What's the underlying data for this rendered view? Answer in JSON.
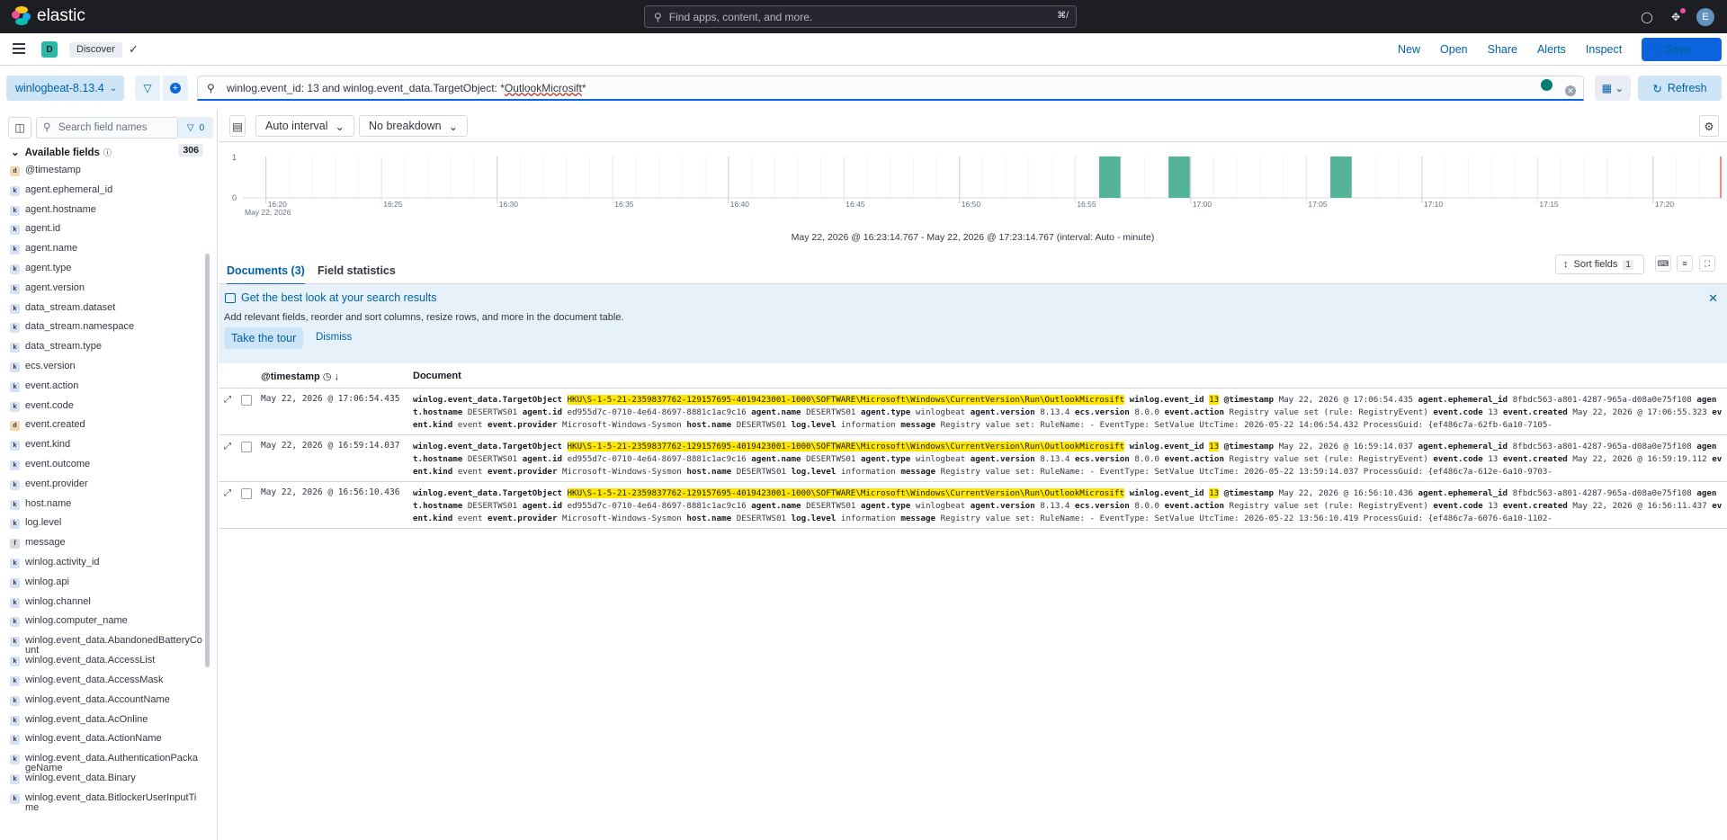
{
  "app": {
    "brand": "elastic",
    "search_placeholder": "Find apps, content, and more.",
    "search_shortcut": "⌘/",
    "avatar_letter": "E"
  },
  "nav": {
    "space_letter": "D",
    "breadcrumb": "Discover",
    "links": {
      "new": "New",
      "open": "Open",
      "share": "Share",
      "alerts": "Alerts",
      "inspect": "Inspect",
      "save": "Save"
    }
  },
  "query": {
    "data_view": "winlogbeat-8.13.4",
    "text_prefix": "winlog.event_id: 13 and winlog.event_data.TargetObject: *",
    "text_wavy": "OutlookMicrosift",
    "text_suffix": "*",
    "refresh": "Refresh"
  },
  "sidebar": {
    "search_placeholder": "Search field names",
    "filter_count": "0",
    "available_label": "Available fields",
    "available_count": "306",
    "fields": [
      {
        "type": "d",
        "name": "@timestamp"
      },
      {
        "type": "k",
        "name": "agent.ephemeral_id"
      },
      {
        "type": "k",
        "name": "agent.hostname"
      },
      {
        "type": "k",
        "name": "agent.id"
      },
      {
        "type": "k",
        "name": "agent.name"
      },
      {
        "type": "k",
        "name": "agent.type"
      },
      {
        "type": "k",
        "name": "agent.version"
      },
      {
        "type": "k",
        "name": "data_stream.dataset"
      },
      {
        "type": "k",
        "name": "data_stream.namespace"
      },
      {
        "type": "k",
        "name": "data_stream.type"
      },
      {
        "type": "k",
        "name": "ecs.version"
      },
      {
        "type": "k",
        "name": "event.action"
      },
      {
        "type": "k",
        "name": "event.code"
      },
      {
        "type": "d",
        "name": "event.created"
      },
      {
        "type": "k",
        "name": "event.kind"
      },
      {
        "type": "k",
        "name": "event.outcome"
      },
      {
        "type": "k",
        "name": "event.provider"
      },
      {
        "type": "k",
        "name": "host.name"
      },
      {
        "type": "k",
        "name": "log.level"
      },
      {
        "type": "f",
        "name": "message"
      },
      {
        "type": "k",
        "name": "winlog.activity_id"
      },
      {
        "type": "k",
        "name": "winlog.api"
      },
      {
        "type": "k",
        "name": "winlog.channel"
      },
      {
        "type": "k",
        "name": "winlog.computer_name"
      },
      {
        "type": "k",
        "name": "winlog.event_data.AbandonedBatteryCount"
      },
      {
        "type": "k",
        "name": "winlog.event_data.AccessList"
      },
      {
        "type": "k",
        "name": "winlog.event_data.AccessMask"
      },
      {
        "type": "k",
        "name": "winlog.event_data.AccountName"
      },
      {
        "type": "k",
        "name": "winlog.event_data.AcOnline"
      },
      {
        "type": "k",
        "name": "winlog.event_data.ActionName"
      },
      {
        "type": "k",
        "name": "winlog.event_data.AuthenticationPackageName"
      },
      {
        "type": "k",
        "name": "winlog.event_data.Binary"
      },
      {
        "type": "k",
        "name": "winlog.event_data.BitlockerUserInputTime"
      }
    ]
  },
  "histogram": {
    "interval_label": "Auto interval",
    "breakdown_label": "No breakdown",
    "y_max": "1",
    "y_min": "0",
    "bar_color": "#54b399",
    "x_ticks": [
      "16:20",
      "16:25",
      "16:30",
      "16:35",
      "16:40",
      "16:45",
      "16:50",
      "16:55",
      "17:00",
      "17:05",
      "17:10",
      "17:15",
      "17:20"
    ],
    "date_label": "May 22, 2026",
    "bars_at_minutes": [
      "16:56",
      "16:59",
      "17:06"
    ],
    "range_text": "May 22, 2026 @ 16:23:14.767 - May 22, 2026 @ 17:23:14.767 (interval: Auto - minute)"
  },
  "tabs": {
    "documents": "Documents (3)",
    "field_stats": "Field statistics",
    "sort_fields": "Sort fields",
    "sort_count": "1"
  },
  "callout": {
    "title": "Get the best look at your search results",
    "text": "Add relevant fields, reorder and sort columns, resize rows, and more in the document table.",
    "tour": "Take the tour",
    "dismiss": "Dismiss"
  },
  "table": {
    "col_timestamp": "@timestamp",
    "col_document": "Document",
    "rows": [
      {
        "ts": "May 22, 2026 @ 17:06:54.435",
        "target": "HKU\\S-1-5-21-2359837762-129157695-4019423001-1000\\SOFTWARE\\Microsoft\\Windows\\CurrentVersion\\Run\\OutlookMicrosift",
        "eid": "13",
        "ts2": "May 22, 2026 @ 17:06:54.435",
        "eph": "8fbdc563-a801-4287-965a-d08a0e75f108",
        "host": "DESERTWS01",
        "aid": "ed955d7c-0710-4e64-8697-8881c1ac9c16",
        "aname": "DESERTWS01",
        "atype": "winlogbeat",
        "aver": "8.13.4",
        "ecs": "8.0.0",
        "action": "Registry value set (rule: RegistryEvent)",
        "code": "13",
        "created": "May 22, 2026 @ 17:06:55.323",
        "kind": "event",
        "provider": "Microsoft-Windows-Sysmon",
        "hname": "DESERTWS01",
        "level": "information",
        "msg": "Registry value set: RuleName: - EventType: SetValue UtcTime: 2026-05-22 14:06:54.432 ProcessGuid: {ef486c7a-62fb-6a10-7105-"
      },
      {
        "ts": "May 22, 2026 @ 16:59:14.037",
        "target": "HKU\\S-1-5-21-2359837762-129157695-4019423001-1000\\SOFTWARE\\Microsoft\\Windows\\CurrentVersion\\Run\\OutlookMicrosift",
        "eid": "13",
        "ts2": "May 22, 2026 @ 16:59:14.037",
        "eph": "8fbdc563-a801-4287-965a-d08a0e75f108",
        "host": "DESERTWS01",
        "aid": "ed955d7c-0710-4e64-8697-8881c1ac9c16",
        "aname": "DESERTWS01",
        "atype": "winlogbeat",
        "aver": "8.13.4",
        "ecs": "8.0.0",
        "action": "Registry value set (rule: RegistryEvent)",
        "code": "13",
        "created": "May 22, 2026 @ 16:59:19.112",
        "kind": "event",
        "provider": "Microsoft-Windows-Sysmon",
        "hname": "DESERTWS01",
        "level": "information",
        "msg": "Registry value set: RuleName: - EventType: SetValue UtcTime: 2026-05-22 13:59:14.037 ProcessGuid: {ef486c7a-612e-6a10-9703-"
      },
      {
        "ts": "May 22, 2026 @ 16:56:10.436",
        "target": "HKU\\S-1-5-21-2359837762-129157695-4019423001-1000\\SOFTWARE\\Microsoft\\Windows\\CurrentVersion\\Run\\OutlookMicrosift",
        "eid": "13",
        "ts2": "May 22, 2026 @ 16:56:10.436",
        "eph": "8fbdc563-a801-4287-965a-d08a0e75f108",
        "host": "DESERTWS01",
        "aid": "ed955d7c-0710-4e64-8697-8881c1ac9c16",
        "aname": "DESERTWS01",
        "atype": "winlogbeat",
        "aver": "8.13.4",
        "ecs": "8.0.0",
        "action": "Registry value set (rule: RegistryEvent)",
        "code": "13",
        "created": "May 22, 2026 @ 16:56:11.437",
        "kind": "event",
        "provider": "Microsoft-Windows-Sysmon",
        "hname": "DESERTWS01",
        "level": "information",
        "msg": "Registry value set: RuleName: - EventType: SetValue UtcTime: 2026-05-22 13:56:10.419 ProcessGuid: {ef486c7a-6076-6a10-1102-"
      }
    ]
  }
}
